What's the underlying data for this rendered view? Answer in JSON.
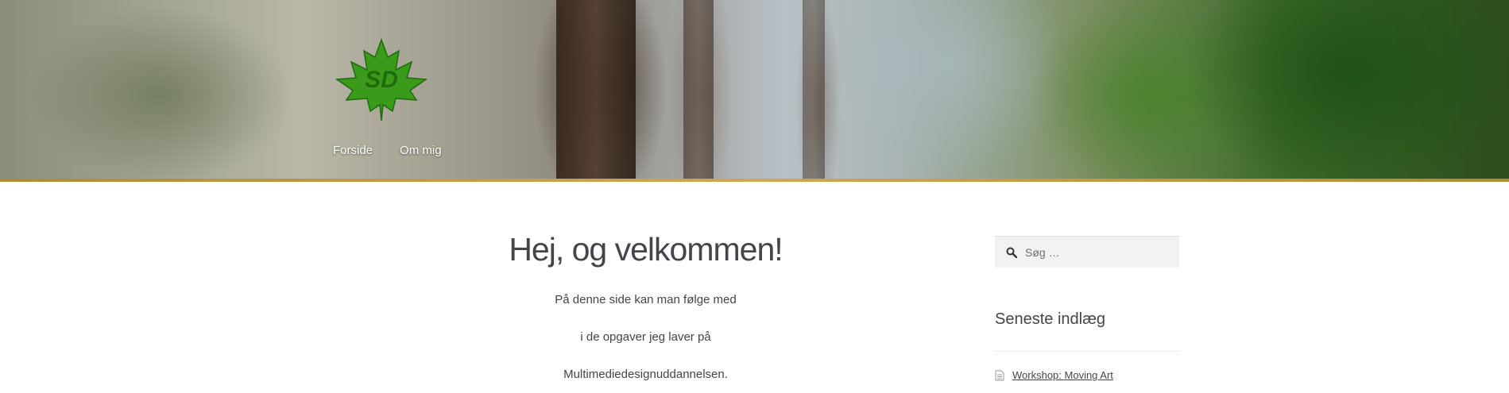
{
  "header": {
    "logo_text": "SD",
    "nav": [
      {
        "label": "Forside"
      },
      {
        "label": "Om mig"
      }
    ]
  },
  "main": {
    "title": "Hej, og velkommen!",
    "paragraphs": [
      "På denne side kan man følge med",
      "i de opgaver jeg laver på",
      "Multimediedesignuddannelsen."
    ]
  },
  "sidebar": {
    "search": {
      "placeholder": "Søg …",
      "value": ""
    },
    "recent_posts_title": "Seneste indlæg",
    "recent_posts": [
      {
        "title": "Workshop: Moving Art"
      }
    ]
  },
  "colors": {
    "leaf": "#3a9a1a",
    "leaf_dark": "#1f6b0d",
    "accent_bar": "#d1a553",
    "text": "#43454b"
  },
  "icons": {
    "search": "search-icon",
    "document": "document-icon",
    "logo": "maple-leaf-logo"
  }
}
